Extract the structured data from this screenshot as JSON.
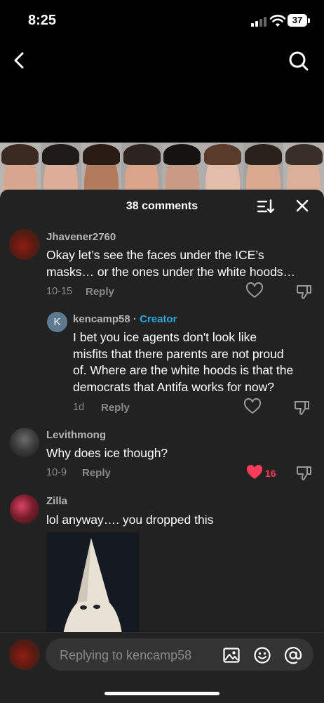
{
  "status": {
    "time": "8:25",
    "battery": "37"
  },
  "sheet": {
    "comments_count": "38 comments"
  },
  "comments": [
    {
      "username": "Jhavener2760",
      "text_lines": [
        "Okay let’s see the faces under the ICE’s",
        "masks… or the ones under the white hoods…"
      ],
      "date": "10-15",
      "reply_label": "Reply"
    },
    {
      "username": "kencamp58",
      "separator": " · ",
      "badge": "Creator",
      "avatar_letter": "K",
      "text_lines": [
        "I bet you ice agents don't look like",
        "misfits that there parents are not proud",
        "of. Where are the white hoods is that the",
        "democrats that Antifa works for now?"
      ],
      "date": "1d",
      "reply_label": "Reply"
    },
    {
      "username": "Levithmong",
      "text_lines": [
        "Why does ice though?"
      ],
      "date": "10-9",
      "reply_label": "Reply",
      "likes": "16",
      "liked": true
    },
    {
      "username": "Zilla",
      "text_lines": [
        "lol anyway…. you dropped this"
      ]
    }
  ],
  "input": {
    "placeholder": "Replying to kencamp58"
  },
  "colors": {
    "accent_blue": "#29a8e0",
    "like_red": "#ff3b5c",
    "sheet_bg": "#222222"
  },
  "icons": [
    "back-icon",
    "search-icon",
    "sort-icon",
    "close-icon",
    "heart-icon",
    "dislike-icon",
    "image-icon",
    "emoji-icon",
    "at-icon"
  ]
}
